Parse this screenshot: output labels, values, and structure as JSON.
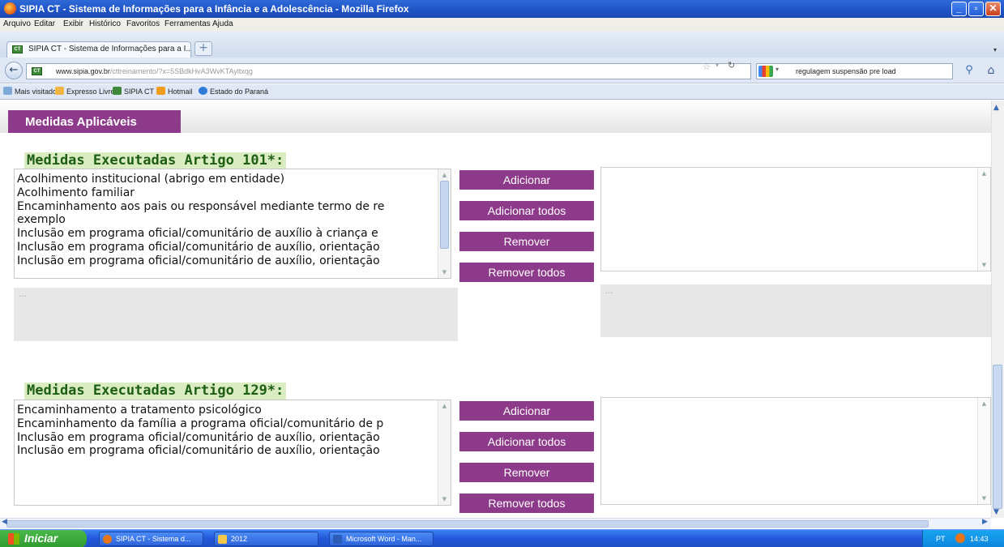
{
  "window": {
    "title": "SIPIA CT - Sistema de Informações para a Infância e a Adolescência - Mozilla Firefox"
  },
  "menubar": {
    "items": [
      "Arquivo",
      "Editar",
      "Exibir",
      "Histórico",
      "Favoritos",
      "Ferramentas",
      "Ajuda"
    ]
  },
  "tabs": {
    "active_label": "SIPIA CT - Sistema de Informações para a I...",
    "new_tab": "+"
  },
  "navigation": {
    "url_host": "www.sipia.gov.br",
    "url_path": "/cttreinamento/?x=5SBdkHvA3WvKTAyltxqg",
    "search_value": "regulagem suspensão pre load"
  },
  "bookmarks": {
    "items": [
      "Mais visitados",
      "Expresso Livre",
      "SIPIA CT",
      "Hotmail",
      "Estado do Paraná"
    ]
  },
  "page": {
    "tab_label": "Medidas Aplicáveis",
    "section101": {
      "title": "Medidas Executadas Artigo 101*:",
      "options": [
        "Acolhimento institucional (abrigo em entidade)",
        "Acolhimento familiar",
        "Encaminhamento aos pais ou responsável mediante termo de re",
        "exemplo",
        "Inclusão em programa oficial/comunitário de auxílio à criança e",
        "Inclusão em programa oficial/comunitário de auxílio, orientação",
        "Inclusão em programa oficial/comunitário de auxílio, orientação"
      ],
      "left_desc": "...",
      "right_desc": "..."
    },
    "section129": {
      "title": "Medidas Executadas Artigo 129*:",
      "options": [
        "Encaminhamento a tratamento psicológico",
        "Encaminhamento da família a programa oficial/comunitário de p",
        "Inclusão em programa oficial/comunitário de auxílio, orientação",
        "Inclusão em programa oficial/comunitário de auxílio, orientação"
      ]
    },
    "buttons": {
      "add": "Adicionar",
      "add_all": "Adicionar todos",
      "remove": "Remover",
      "remove_all": "Remover todos"
    }
  },
  "taskbar": {
    "start": "Iniciar",
    "items": [
      "SIPIA CT - Sistema d...",
      "2012",
      "Microsoft Word - Man..."
    ],
    "lang": "PT",
    "clock": "14:43"
  },
  "colors": {
    "accent": "#8e3a8a",
    "section_title": "#1d5e12",
    "section_bg": "#d9ecc2"
  }
}
